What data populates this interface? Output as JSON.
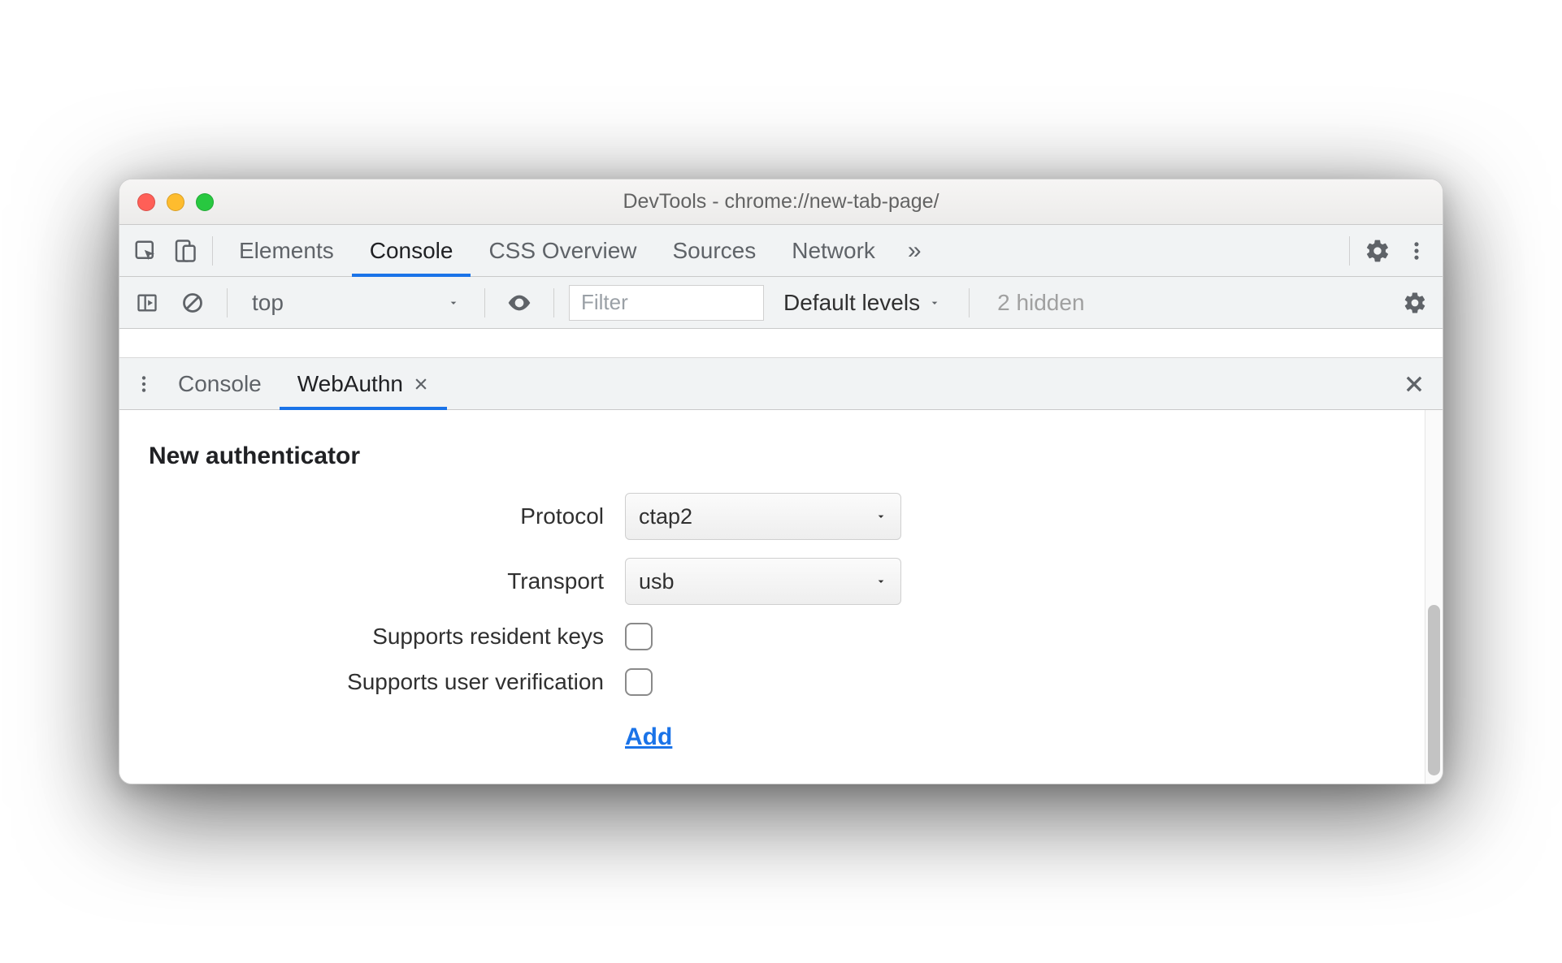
{
  "window": {
    "title": "DevTools - chrome://new-tab-page/"
  },
  "tabs": {
    "items": [
      "Elements",
      "Console",
      "CSS Overview",
      "Sources",
      "Network"
    ],
    "activeIndex": 1
  },
  "consoleBar": {
    "context": "top",
    "filterPlaceholder": "Filter",
    "levelsLabel": "Default levels",
    "hiddenLabel": "2 hidden"
  },
  "drawer": {
    "tabs": [
      {
        "label": "Console",
        "closable": false
      },
      {
        "label": "WebAuthn",
        "closable": true
      }
    ],
    "activeIndex": 1
  },
  "webauthn": {
    "heading": "New authenticator",
    "rows": {
      "protocol": {
        "label": "Protocol",
        "value": "ctap2"
      },
      "transport": {
        "label": "Transport",
        "value": "usb"
      },
      "residentKeys": {
        "label": "Supports resident keys",
        "checked": false
      },
      "userVerification": {
        "label": "Supports user verification",
        "checked": false
      }
    },
    "addLabel": "Add"
  }
}
